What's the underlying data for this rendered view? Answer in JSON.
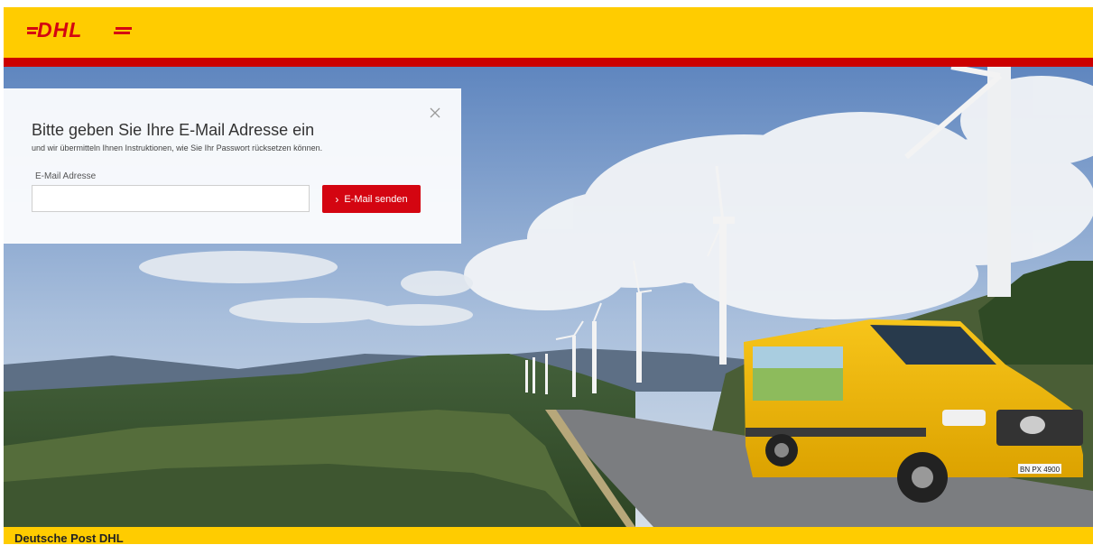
{
  "header": {
    "logo_text": "DHL",
    "brand_color": "#ffcc00",
    "accent_color": "#d40511"
  },
  "dialog": {
    "title": "Bitte geben Sie Ihre E-Mail Adresse ein",
    "subtitle": "und wir übermitteln Ihnen Instruktionen, wie Sie Ihr Passwort rücksetzen können.",
    "email_label": "E-Mail Adresse",
    "email_value": "",
    "email_placeholder": "",
    "submit_label": "E-Mail senden",
    "submit_icon": "chevron-right-icon",
    "close_icon": "close-icon"
  },
  "hero": {
    "van_plate": "BN PX 4900"
  },
  "footer": {
    "brand": "Deutsche Post DHL"
  }
}
